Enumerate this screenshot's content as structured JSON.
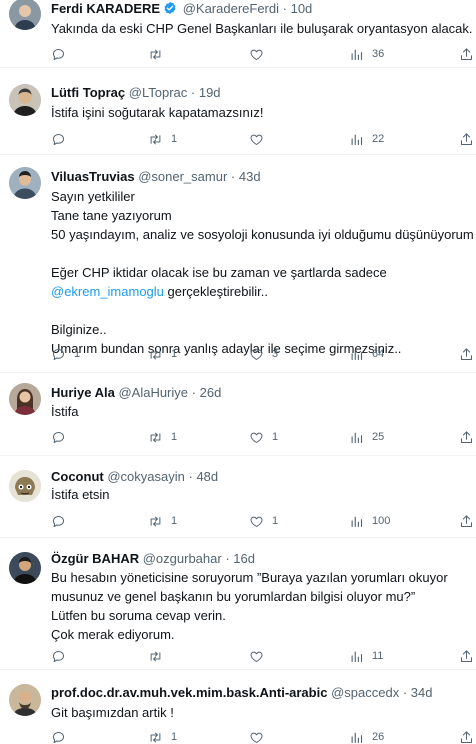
{
  "tweets": [
    {
      "name": "Ferdi KARADERE",
      "handle": "@KaradereFerdi",
      "dot": "·",
      "time": "10d",
      "verified": true,
      "text": [
        "Yakında da eski CHP Genel Başkanları ile buluşarak oryantasyon alacak."
      ],
      "reply": "",
      "retweet": "",
      "like": "",
      "views": "36"
    },
    {
      "name": "Lütfi Topraç",
      "handle": "@LToprac",
      "dot": "·",
      "time": "19d",
      "text": [
        "İstifa işini soğutarak kapatamazsınız!"
      ],
      "reply": "",
      "retweet": "1",
      "like": "",
      "views": "22"
    },
    {
      "name": "ViluasTruvias",
      "handle": "@soner_samur",
      "dot": "·",
      "time": "43d",
      "text_lines": {
        "l1": "Sayın yetkililer",
        "l2": "Tane tane yazıyorum",
        "l3": "50 yaşındayım, analiz ve sosyoloji konusunda iyi olduğumu düşünüyorum",
        "l4": "Eğer CHP iktidar olacak ise bu zaman ve şartlarda sadece",
        "mention": "@ekrem_imamoglu",
        "l5_rest": " gerçekleştirebilir..",
        "l6": "Bilginize..",
        "l7": "Umarım bundan sonra yanlış adaylar ile seçime girmezsiniz.."
      },
      "reply": "1",
      "retweet": "1",
      "like": "3",
      "views": "64"
    },
    {
      "name": "Huriye Ala",
      "handle": "@AlaHuriye",
      "dot": "·",
      "time": "26d",
      "text": [
        "İstifa"
      ],
      "reply": "",
      "retweet": "1",
      "like": "1",
      "views": "25"
    },
    {
      "name": "Coconut",
      "handle": "@cokyasayin",
      "dot": "·",
      "time": "48d",
      "text": [
        "İstifa etsin"
      ],
      "reply": "",
      "retweet": "1",
      "like": "1",
      "views": "100"
    },
    {
      "name": "Özgür BAHAR",
      "handle": "@ozgurbahar",
      "dot": "·",
      "time": "16d",
      "text": [
        "Bu hesabın yöneticisine soruyorum ”Buraya yazılan yorumları okuyor",
        "musunuz ve genel başkanın bu yorumlardan bilgisi oluyor mu?”",
        "Lütfen bu soruma cevap verin.",
        "Çok merak ediyorum."
      ],
      "reply": "",
      "retweet": "",
      "like": "",
      "views": "11"
    },
    {
      "name": "prof.doc.dr.av.muh.vek.mim.bask.Anti-arabic",
      "handle": "@spaccedx",
      "dot": "·",
      "time": "34d",
      "text": [
        "Git başımızdan artik !"
      ],
      "reply": "",
      "retweet": "1",
      "like": "",
      "views": "26"
    }
  ],
  "colors": {
    "text": "#0f1419",
    "secondary": "#536471",
    "link": "#1d9bf0",
    "divider": "#eff3f4",
    "verified": "#1d9bf0"
  },
  "icons": [
    "reply-icon",
    "retweet-icon",
    "like-icon",
    "views-icon",
    "share-icon",
    "verified-badge-icon"
  ]
}
